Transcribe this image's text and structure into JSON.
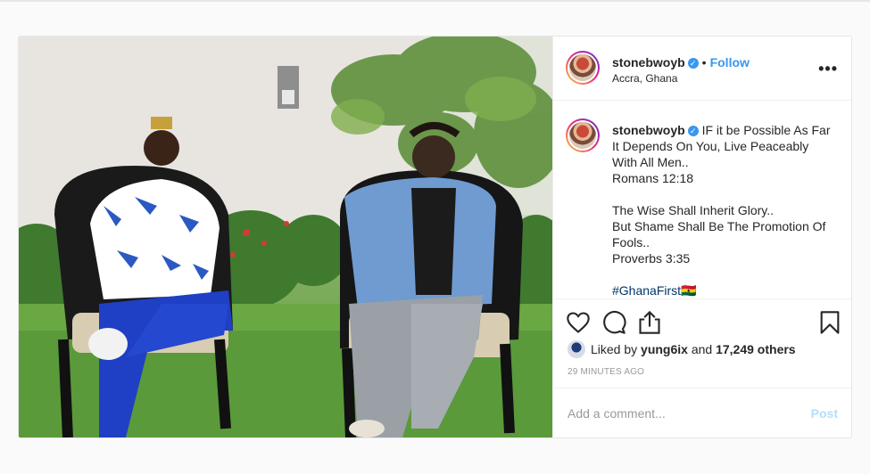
{
  "post": {
    "author": {
      "username": "stonebwoyb",
      "verified_icon": "verified-badge-icon",
      "follow_label": "Follow",
      "separator": "•",
      "location": "Accra, Ghana"
    },
    "more_icon": "more-options-icon",
    "more_label": "•••",
    "caption": {
      "username": "stonebwoyb",
      "text": "IF it be Possible As Far It Depends On You, Live Peaceably With All Men..\nRomans 12:18\n\nThe Wise Shall Inherit Glory..\nBut Shame Shall Be The Promotion Of Fools..\nProverbs 3:35\n\n",
      "hashtag": "#GhanaFirst",
      "flag": "🇬🇭"
    },
    "actions": {
      "like_icon": "heart-icon",
      "comment_icon": "comment-icon",
      "share_icon": "share-icon",
      "save_icon": "bookmark-icon"
    },
    "likes": {
      "prefix": "Liked by",
      "liker": "yung6ix",
      "joiner": "and",
      "others": "17,249 others"
    },
    "timestamp": "29 MINUTES AGO",
    "add_comment": {
      "placeholder": "Add a comment...",
      "post_label": "Post"
    }
  },
  "colors": {
    "link_blue": "#3897f0",
    "post_disabled": "#b2dffc",
    "hashtag": "#003569",
    "border": "#efefef"
  }
}
